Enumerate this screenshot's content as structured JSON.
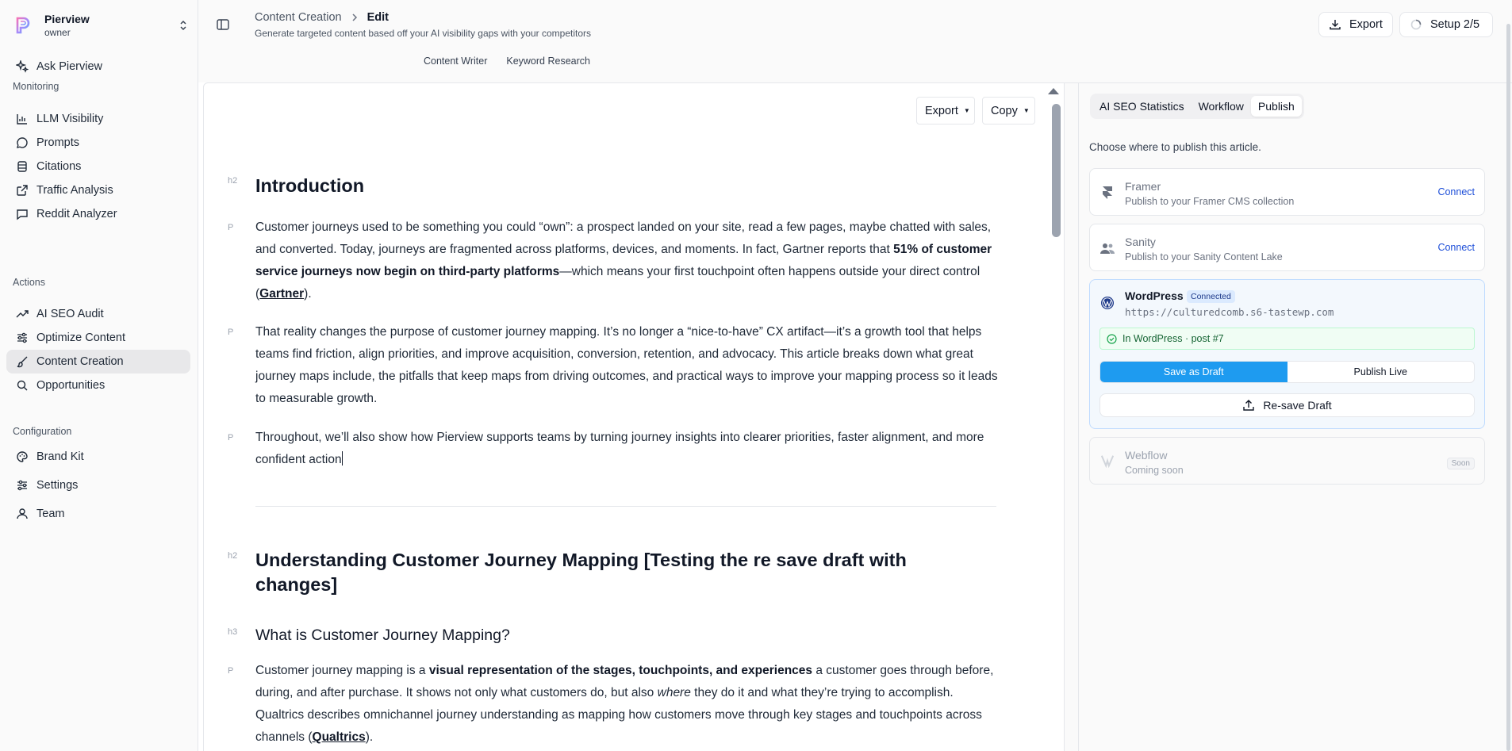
{
  "workspace": {
    "name": "Pierview",
    "role": "owner"
  },
  "sidebar": {
    "ask": "Ask Pierview",
    "sections": {
      "monitoring": "Monitoring",
      "actions": "Actions",
      "configuration": "Configuration"
    },
    "monitoring": [
      "LLM Visibility",
      "Prompts",
      "Citations",
      "Traffic Analysis",
      "Reddit Analyzer"
    ],
    "actions": [
      "AI SEO Audit",
      "Optimize Content",
      "Content Creation",
      "Opportunities"
    ],
    "configuration": [
      "Brand Kit",
      "Settings",
      "Team"
    ],
    "active": "Content Creation"
  },
  "header": {
    "breadcrumb_parent": "Content Creation",
    "breadcrumb_current": "Edit",
    "subtitle": "Generate targeted content based off your AI visibility gaps with your competitors",
    "export_label": "Export",
    "setup_label": "Setup 2/5",
    "tabs": [
      "Content Writer",
      "Keyword Research"
    ]
  },
  "editor": {
    "export_label": "Export",
    "copy_label": "Copy",
    "tags": {
      "h2": "h2",
      "h3": "h3",
      "p": "P"
    },
    "intro_heading": "Introduction",
    "p1": {
      "a": "Customer journeys used to be something you could “own”: a prospect landed on your site, read a few pages, maybe chatted with sales, and converted. Today, journeys are fragmented across platforms, devices, and moments. In fact, Gartner reports that ",
      "b": "51% of customer service journeys now begin on third-party platforms",
      "c": "—which means your first touchpoint often happens outside your direct control (",
      "link": "Gartner",
      "d": ")."
    },
    "p2": "That reality changes the purpose of customer journey mapping. It’s no longer a “nice-to-have” CX artifact—it’s a growth tool that helps teams find friction, align priorities, and improve acquisition, conversion, retention, and advocacy. This article breaks down what great journey maps include, the pitfalls that keep maps from driving outcomes, and practical ways to improve your mapping process so it leads to measurable growth.",
    "p3": "Throughout, we’ll also show how Pierview supports teams by turning journey insights into clearer priorities, faster alignment, and more confident action",
    "section_heading": "Understanding Customer Journey Mapping [Testing the re save draft with changes]",
    "sub_heading": "What is Customer Journey Mapping?",
    "p4": {
      "a": "Customer journey mapping is a ",
      "b": "visual representation of the stages, touchpoints, and experiences",
      "c": " a customer goes through before, during, and after purchase. It shows not only what customers do, but also ",
      "i": "where",
      "d": " they do it and what they’re trying to accomplish. Qualtrics describes omnichannel journey understanding as mapping how customers move through key stages and touchpoints across channels (",
      "link": "Qualtrics",
      "e": ")."
    }
  },
  "panel": {
    "tabs": [
      "AI SEO Statistics",
      "Workflow",
      "Publish"
    ],
    "active_tab": "Publish",
    "description": "Choose where to publish this article.",
    "framer": {
      "title": "Framer",
      "subtitle": "Publish to your Framer CMS collection",
      "action": "Connect"
    },
    "sanity": {
      "title": "Sanity",
      "subtitle": "Publish to your Sanity Content Lake",
      "action": "Connect"
    },
    "wordpress": {
      "title": "WordPress",
      "badge": "Connected",
      "url": "https://culturedcomb.s6-tastewp.com",
      "status": "In WordPress · post #7",
      "save_draft": "Save as Draft",
      "publish_live": "Publish Live",
      "resave": "Re-save Draft"
    },
    "webflow": {
      "title": "Webflow",
      "subtitle": "Coming soon",
      "badge": "Soon"
    }
  },
  "colors": {
    "accent": "#1e9bf0",
    "link": "#1d4ed8",
    "success": "#166534"
  }
}
